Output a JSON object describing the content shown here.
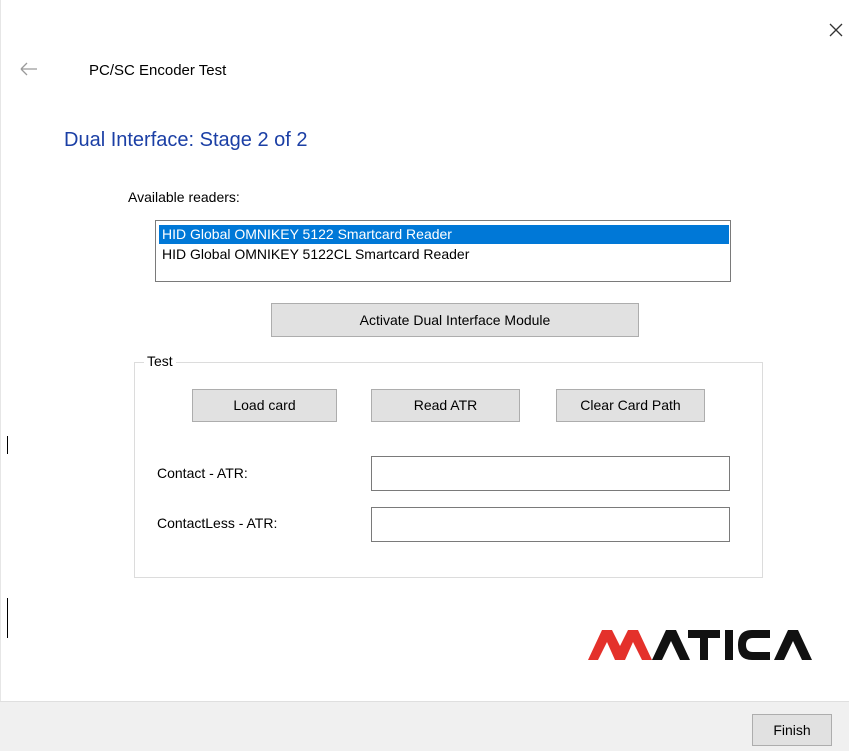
{
  "window": {
    "close_icon": "close-icon",
    "back_icon": "back-arrow-icon"
  },
  "wizard": {
    "title": "PC/SC Encoder Test",
    "stage_title": "Dual Interface: Stage 2 of 2"
  },
  "readers": {
    "label": "Available readers:",
    "items": [
      {
        "label": "HID Global OMNIKEY 5122 Smartcard Reader",
        "selected": true
      },
      {
        "label": "HID Global OMNIKEY 5122CL Smartcard Reader",
        "selected": false
      }
    ]
  },
  "activate_button": "Activate Dual Interface Module",
  "test_group": {
    "title": "Test",
    "load_card_button": "Load card",
    "read_atr_button": "Read ATR",
    "clear_card_path_button": "Clear Card Path",
    "contact_atr_label": "Contact - ATR:",
    "contact_atr_value": "",
    "contactless_atr_label": "ContactLess - ATR:",
    "contactless_atr_value": ""
  },
  "logo": {
    "text": "MATICA",
    "accent_color": "#e4312b",
    "text_color": "#111111"
  },
  "footer": {
    "finish_button": "Finish"
  },
  "colors": {
    "stage_title": "#1b3fa5",
    "selection": "#0078d7",
    "button_bg": "#e1e1e1",
    "footer_bg": "#f0f0f0"
  }
}
